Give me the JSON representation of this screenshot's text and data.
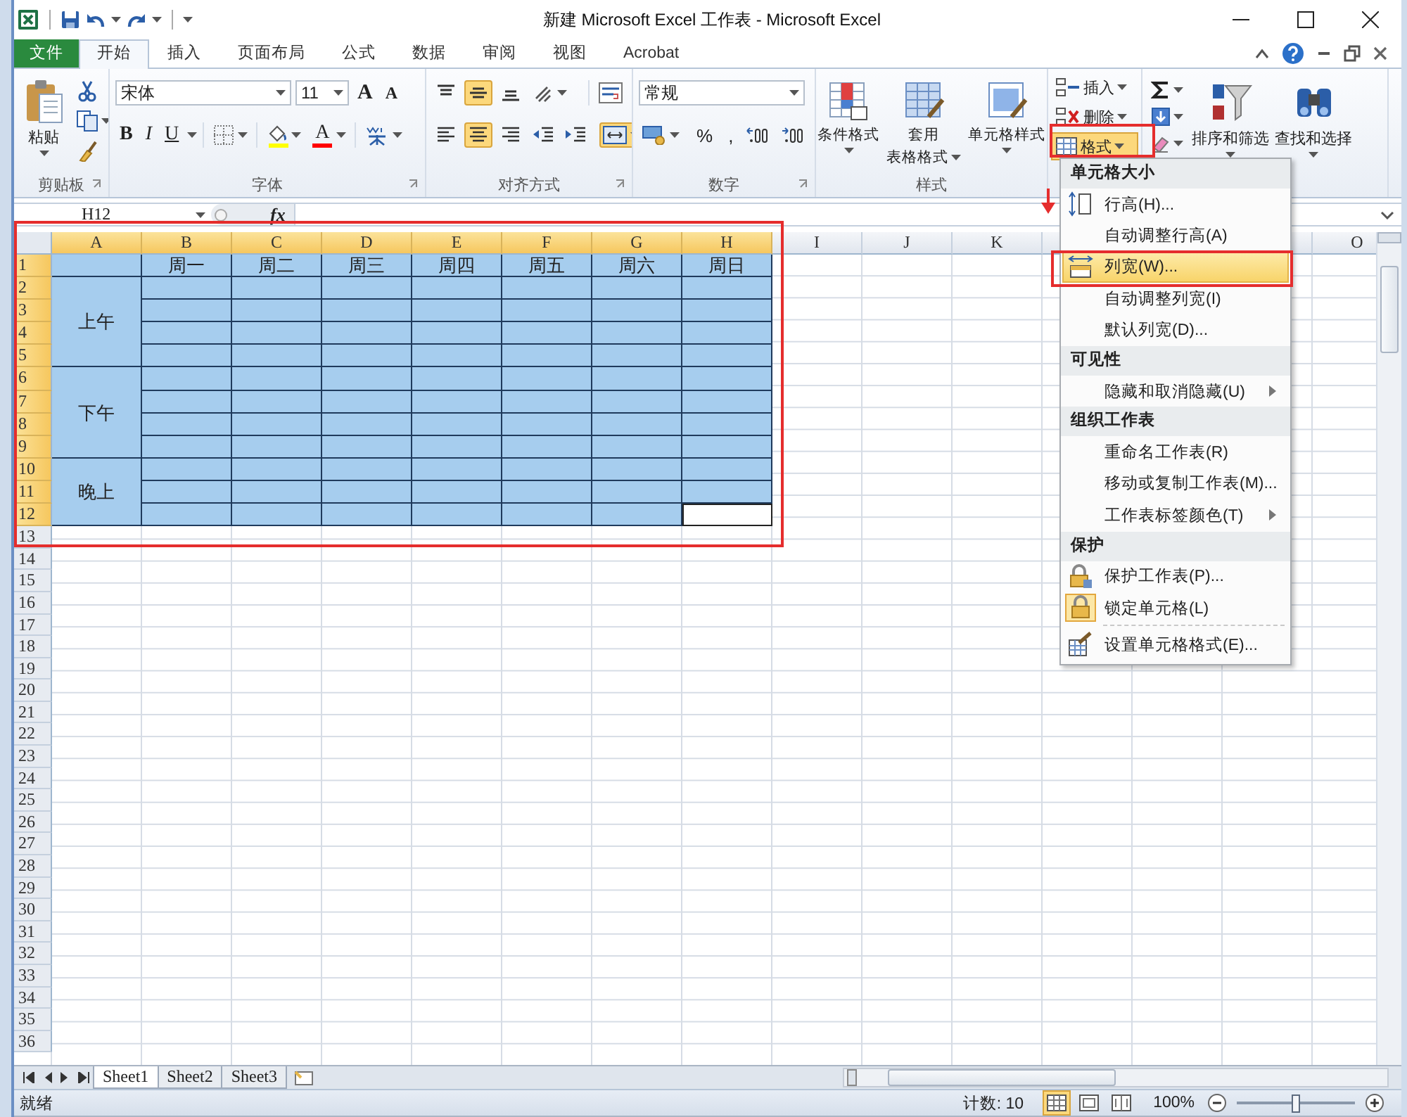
{
  "title_bar": {
    "title": "新建 Microsoft Excel 工作表 - Microsoft Excel"
  },
  "tabs": [
    {
      "label": "文件",
      "kind": "file",
      "selected": false
    },
    {
      "label": "开始",
      "kind": "tab",
      "selected": true
    },
    {
      "label": "插入",
      "kind": "tab",
      "selected": false
    },
    {
      "label": "页面布局",
      "kind": "tab",
      "selected": false
    },
    {
      "label": "公式",
      "kind": "tab",
      "selected": false
    },
    {
      "label": "数据",
      "kind": "tab",
      "selected": false
    },
    {
      "label": "审阅",
      "kind": "tab",
      "selected": false
    },
    {
      "label": "视图",
      "kind": "tab",
      "selected": false
    },
    {
      "label": "Acrobat",
      "kind": "tab",
      "selected": false
    }
  ],
  "ribbon": {
    "clipboard": {
      "label": "剪贴板",
      "paste": "粘贴"
    },
    "font": {
      "label": "字体",
      "font_name": "宋体",
      "font_size": "11",
      "size_buttons": [
        {
          "kind": "grow",
          "label": "A"
        },
        {
          "kind": "shrink",
          "label": "A"
        }
      ],
      "style_buttons": [
        {
          "kind": "bold",
          "label": "B"
        },
        {
          "kind": "italic",
          "label": "I"
        },
        {
          "kind": "underline",
          "label": "U"
        }
      ],
      "fill": {
        "color": "#ffff00"
      },
      "font_color": {
        "label": "A",
        "color": "#ff0000"
      }
    },
    "alignment": {
      "label": "对齐方式",
      "row_1": [
        {
          "kind": "align-top",
          "pressed": false
        },
        {
          "kind": "align-middle",
          "pressed": true
        },
        {
          "kind": "align-bottom",
          "pressed": false
        },
        {
          "kind": "orientation",
          "pressed": false
        },
        {
          "kind": "wrap",
          "pressed": false
        }
      ],
      "row_2": [
        {
          "kind": "align-left",
          "pressed": false
        },
        {
          "kind": "align-center",
          "pressed": true
        },
        {
          "kind": "align-right",
          "pressed": false
        },
        {
          "kind": "indent-decrease",
          "pressed": false
        },
        {
          "kind": "indent-increase",
          "pressed": false
        },
        {
          "kind": "merge",
          "pressed": true
        }
      ]
    },
    "number": {
      "label": "数字",
      "format": "常规",
      "buttons": [
        {
          "kind": "accounting"
        },
        {
          "kind": "text",
          "label": "%"
        },
        {
          "kind": "text",
          "label": ","
        },
        {
          "kind": "decimal-increase"
        },
        {
          "kind": "decimal-decrease"
        }
      ]
    },
    "styles": {
      "label": "样式",
      "buttons": [
        {
          "kind": "conditional",
          "lines": [
            "条件格式"
          ]
        },
        {
          "kind": "table",
          "lines": [
            "套用",
            "表格格式"
          ]
        },
        {
          "kind": "cell-style",
          "lines": [
            "单元格样式"
          ]
        }
      ]
    },
    "cells": {
      "buttons": [
        {
          "kind": "insert",
          "label": "插入",
          "pressed": false
        },
        {
          "kind": "delete",
          "label": "删除",
          "pressed": false
        },
        {
          "kind": "format",
          "label": "格式",
          "pressed": true
        }
      ]
    },
    "editing": {
      "buttons": [
        {
          "kind": "sort",
          "lines": [
            "排序和筛选"
          ]
        },
        {
          "kind": "find",
          "lines": [
            "查找和选择"
          ]
        }
      ]
    }
  },
  "formula_bar": {
    "name_box": "H12",
    "fx": "fx"
  },
  "sheet": {
    "columns": [
      {
        "label": "A",
        "highlighted": true
      },
      {
        "label": "B",
        "highlighted": true
      },
      {
        "label": "C",
        "highlighted": true
      },
      {
        "label": "D",
        "highlighted": true
      },
      {
        "label": "E",
        "highlighted": true
      },
      {
        "label": "F",
        "highlighted": true
      },
      {
        "label": "G",
        "highlighted": true
      },
      {
        "label": "H",
        "highlighted": true
      },
      {
        "label": "I",
        "highlighted": false
      },
      {
        "label": "J",
        "highlighted": false
      },
      {
        "label": "K",
        "highlighted": false
      },
      {
        "label": "O",
        "highlighted": false
      }
    ],
    "rows": [
      {
        "label": "1",
        "highlighted": true
      },
      {
        "label": "2",
        "highlighted": true
      },
      {
        "label": "3",
        "highlighted": true
      },
      {
        "label": "4",
        "highlighted": true
      },
      {
        "label": "5",
        "highlighted": true
      },
      {
        "label": "6",
        "highlighted": true
      },
      {
        "label": "7",
        "highlighted": true
      },
      {
        "label": "8",
        "highlighted": true
      },
      {
        "label": "9",
        "highlighted": true
      },
      {
        "label": "10",
        "highlighted": true
      },
      {
        "label": "11",
        "highlighted": true
      },
      {
        "label": "12",
        "highlighted": true
      },
      {
        "label": "13",
        "highlighted": false
      },
      {
        "label": "14",
        "highlighted": false
      },
      {
        "label": "15",
        "highlighted": false
      },
      {
        "label": "16",
        "highlighted": false
      },
      {
        "label": "17",
        "highlighted": false
      },
      {
        "label": "18",
        "highlighted": false
      },
      {
        "label": "19",
        "highlighted": false
      },
      {
        "label": "20",
        "highlighted": false
      },
      {
        "label": "21",
        "highlighted": false
      },
      {
        "label": "22",
        "highlighted": false
      },
      {
        "label": "23",
        "highlighted": false
      },
      {
        "label": "24",
        "highlighted": false
      },
      {
        "label": "25",
        "highlighted": false
      },
      {
        "label": "26",
        "highlighted": false
      },
      {
        "label": "27",
        "highlighted": false
      },
      {
        "label": "28",
        "highlighted": false
      },
      {
        "label": "29",
        "highlighted": false
      },
      {
        "label": "30",
        "highlighted": false
      },
      {
        "label": "31",
        "highlighted": false
      },
      {
        "label": "32",
        "highlighted": false
      },
      {
        "label": "33",
        "highlighted": false
      },
      {
        "label": "34",
        "highlighted": false
      },
      {
        "label": "35",
        "highlighted": false
      },
      {
        "label": "36",
        "highlighted": false
      }
    ],
    "table": {
      "days": [
        "周一",
        "周二",
        "周三",
        "周四",
        "周五",
        "周六",
        "周日"
      ],
      "periods": [
        {
          "label": "上午",
          "rows": [
            {
              "active_end": false
            },
            {
              "active_end": false
            },
            {
              "active_end": false
            },
            {
              "active_end": false
            }
          ]
        },
        {
          "label": "下午",
          "rows": [
            {
              "active_end": false
            },
            {
              "active_end": false
            },
            {
              "active_end": false
            },
            {
              "active_end": false
            }
          ]
        },
        {
          "label": "晚上",
          "rows": [
            {
              "active_end": false
            },
            {
              "active_end": false
            },
            {
              "active_end": true
            }
          ]
        }
      ]
    }
  },
  "menu": {
    "sections": [
      {
        "title": "单元格大小",
        "items": [
          {
            "label": "行高(H)...",
            "kind": "row-height",
            "selected": false,
            "checked": false,
            "submenu": false
          },
          {
            "label": "自动调整行高(A)",
            "kind": "plain",
            "selected": false,
            "checked": false,
            "submenu": false
          },
          {
            "label": "列宽(W)...",
            "kind": "column-width",
            "selected": true,
            "checked": false,
            "submenu": false
          },
          {
            "label": "自动调整列宽(I)",
            "kind": "plain",
            "selected": false,
            "checked": false,
            "submenu": false
          },
          {
            "label": "默认列宽(D)...",
            "kind": "plain",
            "selected": false,
            "checked": false,
            "submenu": false
          }
        ]
      },
      {
        "title": "可见性",
        "items": [
          {
            "label": "隐藏和取消隐藏(U)",
            "kind": "plain",
            "selected": false,
            "checked": false,
            "submenu": true
          }
        ]
      },
      {
        "title": "组织工作表",
        "items": [
          {
            "label": "重命名工作表(R)",
            "kind": "plain",
            "selected": false,
            "checked": false,
            "submenu": false
          },
          {
            "label": "移动或复制工作表(M)...",
            "kind": "plain",
            "selected": false,
            "checked": false,
            "submenu": false
          },
          {
            "label": "工作表标签颜色(T)",
            "kind": "plain",
            "selected": false,
            "checked": false,
            "submenu": true
          }
        ]
      },
      {
        "title": "保护",
        "items": [
          {
            "label": "保护工作表(P)...",
            "kind": "protect",
            "selected": false,
            "checked": false,
            "submenu": false
          },
          {
            "label": "锁定单元格(L)",
            "kind": "lock",
            "selected": false,
            "checked": true,
            "submenu": false
          },
          {
            "label": "设置单元格格式(E)...",
            "kind": "format-cells",
            "selected": false,
            "checked": false,
            "submenu": false
          }
        ]
      }
    ]
  },
  "sheet_tabs": [
    {
      "label": "Sheet1",
      "selected": true
    },
    {
      "label": "Sheet2",
      "selected": false
    },
    {
      "label": "Sheet3",
      "selected": false
    }
  ],
  "status_bar": {
    "ready": "就绪",
    "count": "计数: 10",
    "views": [
      {
        "kind": "normal",
        "selected": true
      },
      {
        "kind": "page-layout",
        "selected": false
      },
      {
        "kind": "page-break",
        "selected": false
      }
    ],
    "zoom": "100%",
    "zoom_slider": {
      "level": 0.5
    }
  }
}
